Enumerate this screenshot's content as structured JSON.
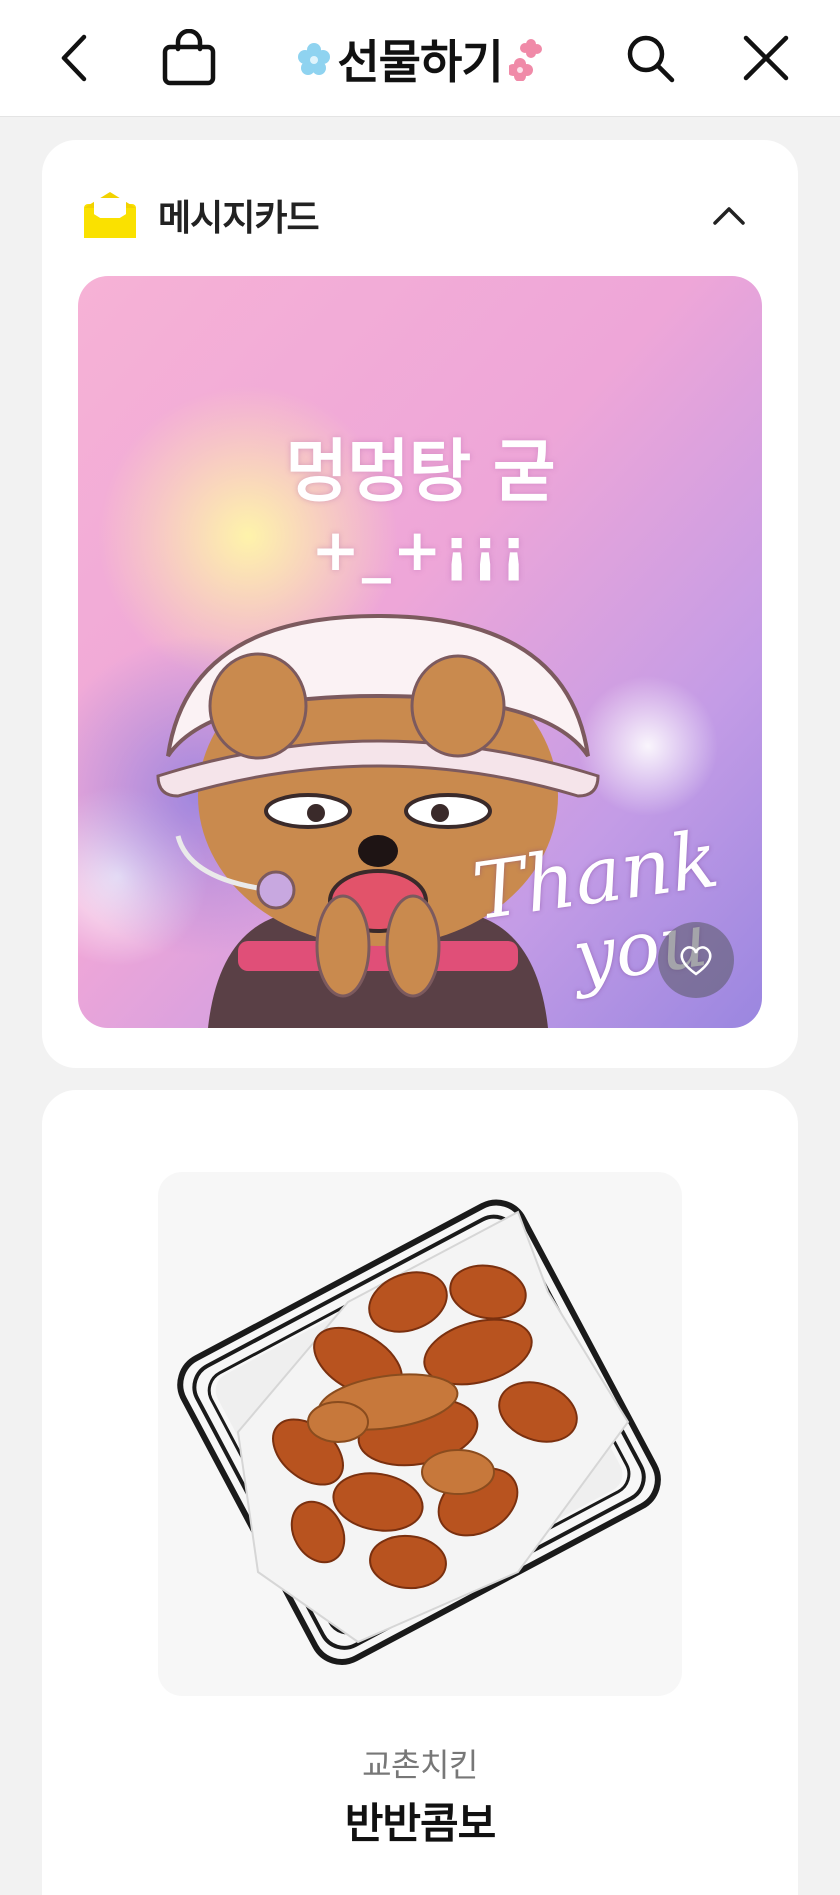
{
  "header": {
    "title": "선물하기",
    "back_icon": "chevron-left-icon",
    "bag_icon": "shopping-bag-icon",
    "search_icon": "search-icon",
    "close_icon": "close-icon"
  },
  "message_card": {
    "label": "메시지카드",
    "icon": "envelope-icon",
    "toggle_icon": "chevron-up-icon",
    "card_text_line1": "멍멍탕 굳",
    "card_text_line2": "+_+¡¡¡",
    "thank_you_line1": "Thank",
    "thank_you_line2": "you",
    "heart_icon": "heart-icon"
  },
  "product": {
    "brand": "교촌치킨",
    "name": "반반콤보"
  },
  "colors": {
    "accent_yellow": "#FAE100",
    "background": "#F2F2F2",
    "card_gradient_pink": "#F4A6C8",
    "card_gradient_purple": "#A98BE0"
  }
}
